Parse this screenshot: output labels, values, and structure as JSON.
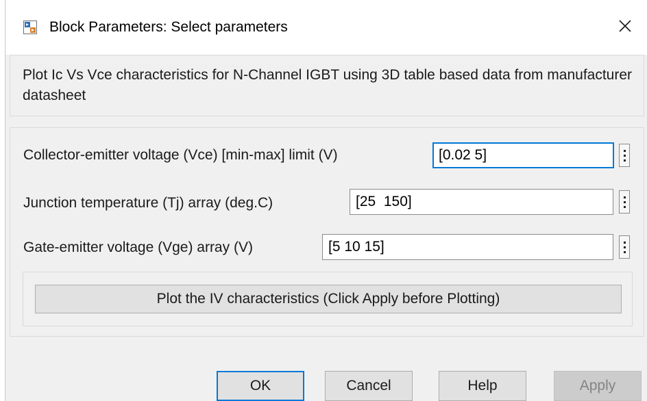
{
  "window": {
    "title": "Block Parameters: Select parameters",
    "app_icon": "simulink-block-icon",
    "close_icon": "close-icon"
  },
  "description": {
    "text": "Plot Ic Vs Vce characteristics for N-Channel IGBT using 3D table based data from manufacturer datasheet"
  },
  "parameters": [
    {
      "label": "Collector-emitter voltage (Vce) [min-max] limit (V)",
      "value": "[0.02 5]",
      "focused": true
    },
    {
      "label": "Junction temperature (Tj) array (deg.C)",
      "value": "[25  150]",
      "focused": false
    },
    {
      "label": "Gate-emitter voltage (Vge) array (V)",
      "value": "[5 10 15]",
      "focused": false
    }
  ],
  "plot_button": {
    "label": "Plot the IV characteristics (Click Apply before Plotting)"
  },
  "footer": {
    "ok_label": "OK",
    "cancel_label": "Cancel",
    "help_label": "Help",
    "apply_label": "Apply"
  },
  "colors": {
    "accent": "#0078d7",
    "dialog_background": "#f0f0f0",
    "button_face": "#e1e1e1",
    "disabled_text": "#838383"
  }
}
